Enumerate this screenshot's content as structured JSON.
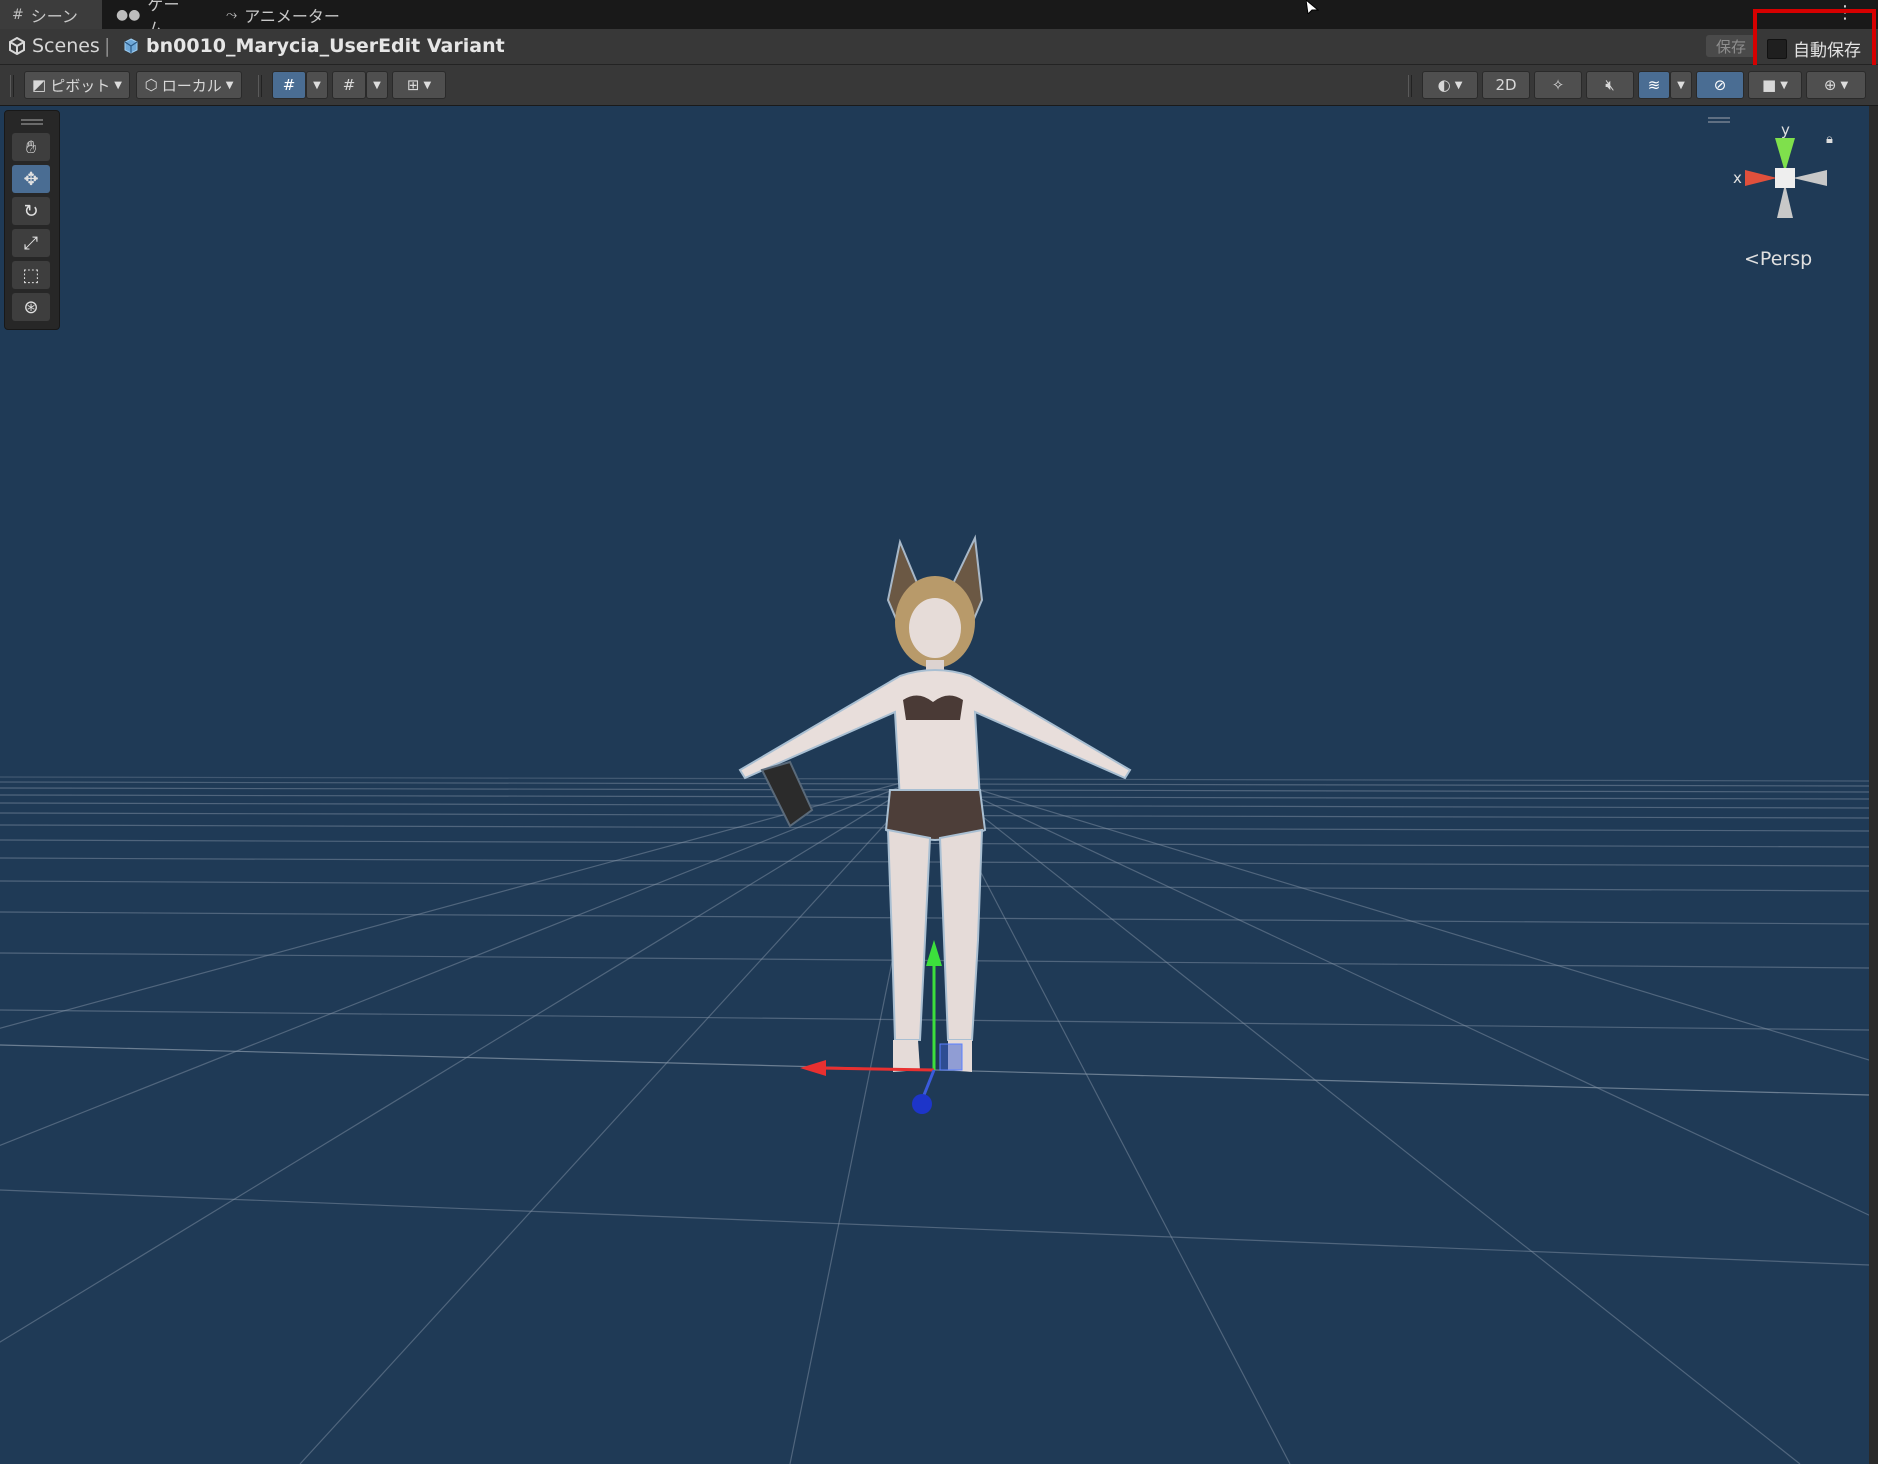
{
  "tabs": [
    {
      "label": "シーン",
      "icon": "hash-icon",
      "active": true
    },
    {
      "label": "ゲーム",
      "icon": "gamepad-icon",
      "active": false
    },
    {
      "label": "アニメーター",
      "icon": "animator-icon",
      "active": false
    }
  ],
  "breadcrumb": {
    "root": "Scenes",
    "separator": "|",
    "prefab": "bn0010_Marycia_UserEdit Variant"
  },
  "header": {
    "save_label": "保存",
    "autosave_label": "自動保存",
    "autosave_checked": false
  },
  "toolbar": {
    "pivot_label": "ピボット",
    "space_label": "ローカル",
    "mode_2d_label": "2D"
  },
  "tools": [
    "hand-tool",
    "move-tool",
    "rotate-tool",
    "scale-tool",
    "rect-tool",
    "transform-tool"
  ],
  "active_tool": "move-tool",
  "gizmo": {
    "x_label": "x",
    "y_label": "y",
    "projection_label": "Persp"
  },
  "colors": {
    "viewport_bg": "#1f3a56",
    "highlight_box": "#d60000",
    "active_button": "#4a6d93"
  }
}
